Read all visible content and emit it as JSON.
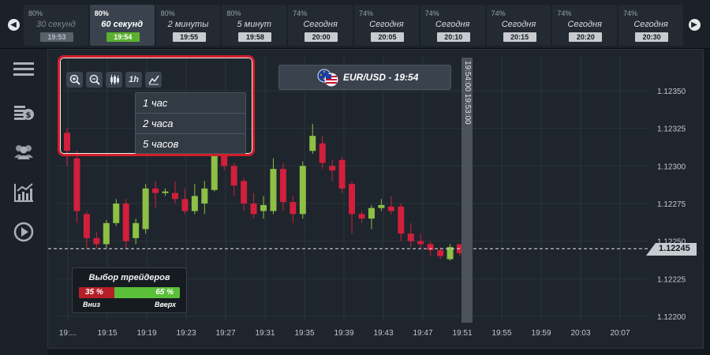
{
  "expiry_bar": {
    "tiles": [
      {
        "pct": "80%",
        "name": "30 секунд",
        "time": "19:53",
        "state": "dim"
      },
      {
        "pct": "80%",
        "name": "60 секунд",
        "time": "19:54",
        "state": "active"
      },
      {
        "pct": "80%",
        "name": "2 минуты",
        "time": "19:55",
        "state": "normal"
      },
      {
        "pct": "80%",
        "name": "5 минут",
        "time": "19:58",
        "state": "normal"
      },
      {
        "pct": "74%",
        "name": "Сегодня",
        "time": "20:00",
        "state": "normal"
      },
      {
        "pct": "74%",
        "name": "Сегодня",
        "time": "20:05",
        "state": "normal"
      },
      {
        "pct": "74%",
        "name": "Сегодня",
        "time": "20:10",
        "state": "normal"
      },
      {
        "pct": "74%",
        "name": "Сегодня",
        "time": "20:15",
        "state": "normal"
      },
      {
        "pct": "74%",
        "name": "Сегодня",
        "time": "20:20",
        "state": "normal"
      },
      {
        "pct": "74%",
        "name": "Сегодня",
        "time": "20:30",
        "state": "normal"
      }
    ],
    "prev_icon": "arrow-left-icon",
    "next_icon": "arrow-right-icon"
  },
  "sidebar": {
    "items": [
      {
        "icon": "menu-icon"
      },
      {
        "icon": "coins-icon"
      },
      {
        "icon": "users-icon"
      },
      {
        "icon": "analytics-icon"
      },
      {
        "icon": "play-icon"
      }
    ]
  },
  "toolbar": {
    "buttons": [
      "zoom-in-icon",
      "zoom-out-icon",
      "candles-icon",
      "1h",
      "line-chart-icon"
    ],
    "timeframe_label": "1h",
    "dropdown": [
      "1 час",
      "2 часа",
      "5 часов"
    ]
  },
  "pair": {
    "label": "EUR/USD - 19:54"
  },
  "time_marker": {
    "label": "19:54:00  19:53:00"
  },
  "current_price": "1.12245",
  "traders": {
    "title": "Выбор трейдеров",
    "down_pct": 35,
    "up_pct": 65,
    "down_text": "35 %",
    "up_text": "65 %",
    "down_label": "Вниз",
    "up_label": "Вверх"
  },
  "colors": {
    "bull": "#8dc045",
    "bear": "#d21f3c",
    "grid": "#2b333c",
    "active_time": "#5bb12f"
  },
  "chart_data": {
    "type": "candlestick",
    "y_ticks": [
      "1.12350",
      "1.12325",
      "1.12300",
      "1.12275",
      "1.12250",
      "1.12225",
      "1.12200"
    ],
    "y_tick_values": [
      1.1235,
      1.12325,
      1.123,
      1.12275,
      1.1225,
      1.12225,
      1.122
    ],
    "x_ticks": [
      "19:...",
      "19:15",
      "19:19",
      "19:23",
      "19:27",
      "19:31",
      "19:35",
      "19:39",
      "19:43",
      "19:47",
      "19:51",
      "19:55",
      "19:59",
      "20:03",
      "20:07"
    ],
    "ylim": [
      1.122,
      1.1236
    ],
    "current_price": 1.12245,
    "candles": [
      {
        "o": 1.12322,
        "c": 1.1231,
        "h": 1.12325,
        "l": 1.123
      },
      {
        "o": 1.12305,
        "c": 1.1227,
        "h": 1.1231,
        "l": 1.12262
      },
      {
        "o": 1.12268,
        "c": 1.12252,
        "h": 1.1227,
        "l": 1.12245
      },
      {
        "o": 1.12252,
        "c": 1.12248,
        "h": 1.12256,
        "l": 1.12245
      },
      {
        "o": 1.12248,
        "c": 1.12262,
        "h": 1.12264,
        "l": 1.12245
      },
      {
        "o": 1.12262,
        "c": 1.12275,
        "h": 1.12278,
        "l": 1.1226
      },
      {
        "o": 1.12275,
        "c": 1.1225,
        "h": 1.12278,
        "l": 1.12245
      },
      {
        "o": 1.12252,
        "c": 1.12262,
        "h": 1.12265,
        "l": 1.12248
      },
      {
        "o": 1.12258,
        "c": 1.12285,
        "h": 1.12288,
        "l": 1.12255
      },
      {
        "o": 1.12285,
        "c": 1.12282,
        "h": 1.1229,
        "l": 1.12272
      },
      {
        "o": 1.12283,
        "c": 1.12283,
        "h": 1.12285,
        "l": 1.1228
      },
      {
        "o": 1.12282,
        "c": 1.12278,
        "h": 1.1229,
        "l": 1.12275
      },
      {
        "o": 1.12278,
        "c": 1.1227,
        "h": 1.12285,
        "l": 1.12268
      },
      {
        "o": 1.1227,
        "c": 1.1228,
        "h": 1.12288,
        "l": 1.12268
      },
      {
        "o": 1.12275,
        "c": 1.12285,
        "h": 1.1229,
        "l": 1.12268
      },
      {
        "o": 1.12284,
        "c": 1.1231,
        "h": 1.12312,
        "l": 1.12283
      },
      {
        "o": 1.1231,
        "c": 1.123,
        "h": 1.12315,
        "l": 1.12297
      },
      {
        "o": 1.123,
        "c": 1.12287,
        "h": 1.12302,
        "l": 1.1228
      },
      {
        "o": 1.1229,
        "c": 1.12275,
        "h": 1.12292,
        "l": 1.1227
      },
      {
        "o": 1.12275,
        "c": 1.12268,
        "h": 1.12282,
        "l": 1.12265
      },
      {
        "o": 1.1227,
        "c": 1.12274,
        "h": 1.1228,
        "l": 1.12265
      },
      {
        "o": 1.1227,
        "c": 1.12298,
        "h": 1.12305,
        "l": 1.12268
      },
      {
        "o": 1.12298,
        "c": 1.12276,
        "h": 1.12302,
        "l": 1.1227
      },
      {
        "o": 1.12276,
        "c": 1.12268,
        "h": 1.1228,
        "l": 1.12262
      },
      {
        "o": 1.12268,
        "c": 1.123,
        "h": 1.12303,
        "l": 1.12265
      },
      {
        "o": 1.1231,
        "c": 1.1232,
        "h": 1.12328,
        "l": 1.12308
      },
      {
        "o": 1.12315,
        "c": 1.12302,
        "h": 1.1232,
        "l": 1.12298
      },
      {
        "o": 1.123,
        "c": 1.12297,
        "h": 1.12304,
        "l": 1.1229
      },
      {
        "o": 1.12304,
        "c": 1.12285,
        "h": 1.12306,
        "l": 1.12282
      },
      {
        "o": 1.12288,
        "c": 1.12268,
        "h": 1.1229,
        "l": 1.12255
      },
      {
        "o": 1.12268,
        "c": 1.12265,
        "h": 1.1227,
        "l": 1.12262
      },
      {
        "o": 1.12265,
        "c": 1.12272,
        "h": 1.12274,
        "l": 1.12258
      },
      {
        "o": 1.12272,
        "c": 1.12274,
        "h": 1.12278,
        "l": 1.1227
      },
      {
        "o": 1.12273,
        "c": 1.1227,
        "h": 1.1228,
        "l": 1.12268
      },
      {
        "o": 1.12273,
        "c": 1.12255,
        "h": 1.12275,
        "l": 1.1225
      },
      {
        "o": 1.12255,
        "c": 1.1225,
        "h": 1.12262,
        "l": 1.12246
      },
      {
        "o": 1.1225,
        "c": 1.12248,
        "h": 1.12255,
        "l": 1.12245
      },
      {
        "o": 1.12248,
        "c": 1.12244,
        "h": 1.1225,
        "l": 1.1224
      },
      {
        "o": 1.12244,
        "c": 1.1224,
        "h": 1.12246,
        "l": 1.12238
      },
      {
        "o": 1.12238,
        "c": 1.12246,
        "h": 1.12248,
        "l": 1.12237
      },
      {
        "o": 1.12248,
        "c": 1.12242,
        "h": 1.12248,
        "l": 1.1224
      }
    ]
  }
}
